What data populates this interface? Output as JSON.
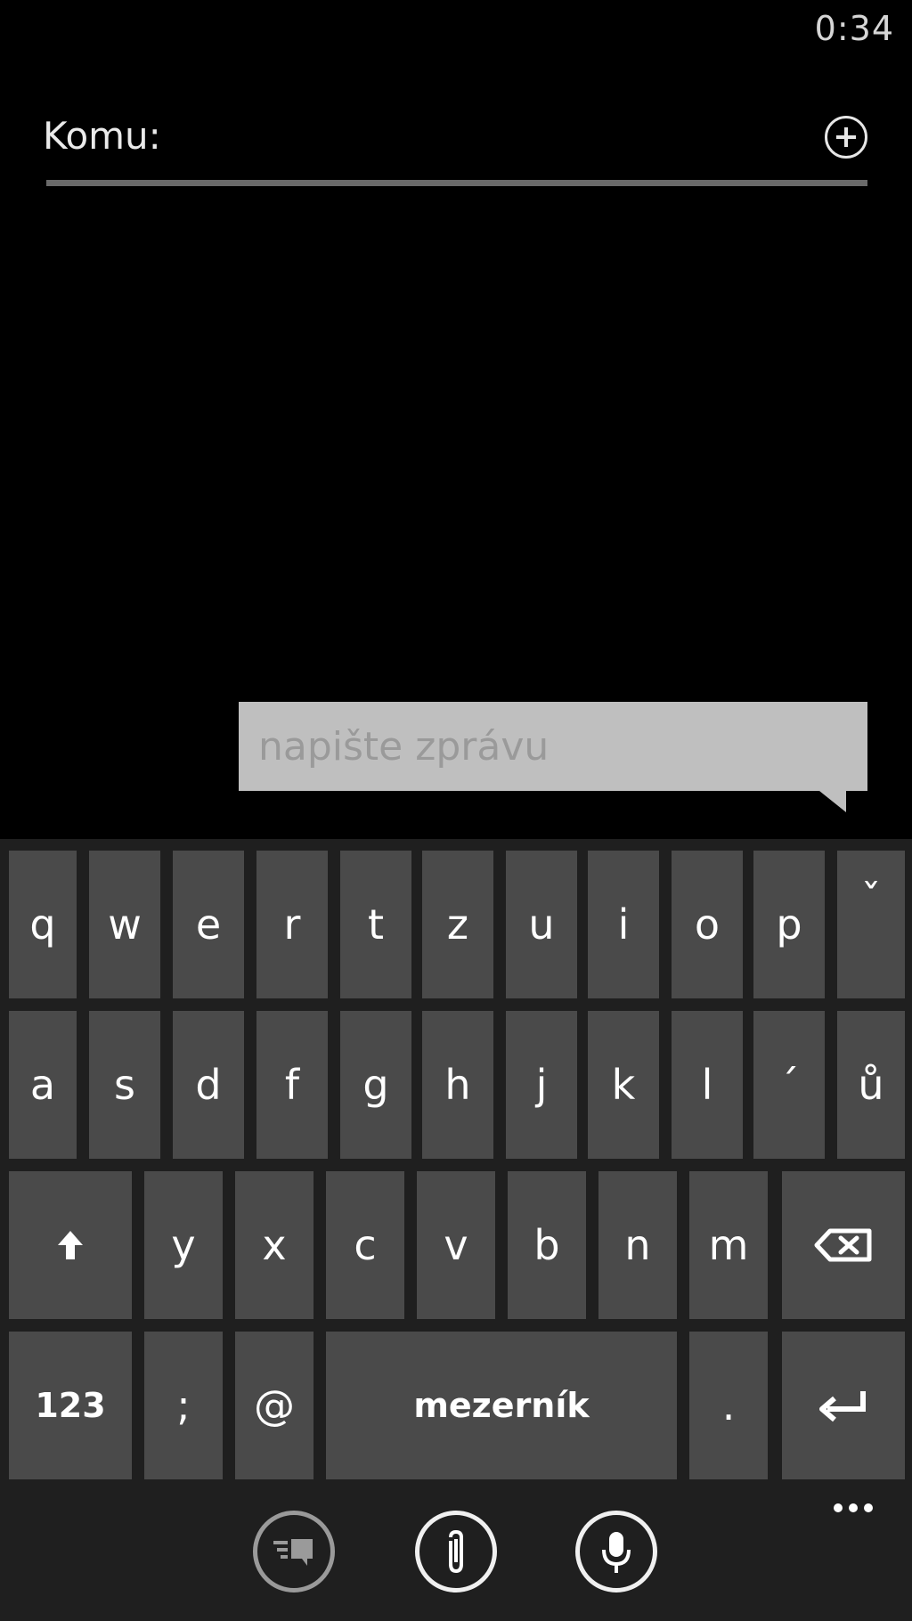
{
  "status": {
    "time": "0:34"
  },
  "to_field": {
    "label": "Komu:"
  },
  "compose": {
    "placeholder": "napište zprávu"
  },
  "keyboard": {
    "row1": [
      "q",
      "w",
      "e",
      "r",
      "t",
      "z",
      "u",
      "i",
      "o",
      "p",
      "ˇ"
    ],
    "row2": [
      "a",
      "s",
      "d",
      "f",
      "g",
      "h",
      "j",
      "k",
      "l",
      "´",
      "ů"
    ],
    "row3_letters": [
      "y",
      "x",
      "c",
      "v",
      "b",
      "n",
      "m"
    ],
    "row4": {
      "numbers": "123",
      "semicolon": ";",
      "at": "@",
      "space": "mezerník",
      "period": "."
    }
  },
  "appbar": {
    "icons": [
      "quick-reply-icon",
      "attach-icon",
      "microphone-icon",
      "more-icon"
    ]
  },
  "colors": {
    "background": "#000000",
    "key": "#4a4a4a",
    "keyboard_bg": "#1f1f1f",
    "compose_bg": "#bfbfbf"
  }
}
